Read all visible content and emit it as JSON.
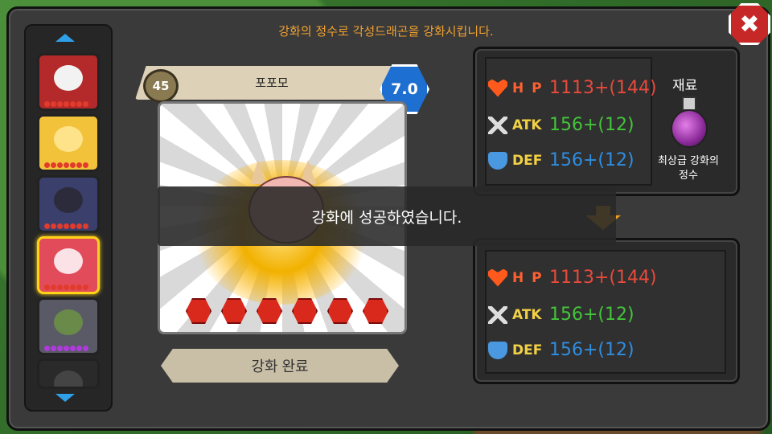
{
  "header": {
    "instruction": "강화의 정수로 각성드래곤을 강화시킵니다."
  },
  "close_button": {
    "icon": "close-icon",
    "glyph": "✖"
  },
  "dragon_list": {
    "items": [
      {
        "name": "dragon-1",
        "bg": "#b42a2a",
        "face": "#f2f2f2",
        "star_color": "#e23b2b",
        "selected": false
      },
      {
        "name": "dragon-2",
        "bg": "#f2c33a",
        "face": "#ffe38a",
        "star_color": "#e23b2b",
        "selected": false
      },
      {
        "name": "dragon-3",
        "bg": "#3b3f6b",
        "face": "#2b2b3b",
        "star_color": "#e23b2b",
        "selected": false
      },
      {
        "name": "dragon-4",
        "bg": "#e24b5a",
        "face": "#fbe2e6",
        "star_color": "#e23b2b",
        "selected": true
      },
      {
        "name": "dragon-5",
        "bg": "#5a5a66",
        "face": "#6a8a4a",
        "star_color": "#b03ae0",
        "selected": false
      },
      {
        "name": "dragon-6",
        "bg": "#2a2a2a",
        "face": "#444",
        "star_color": "#e23b2b",
        "selected": false
      }
    ]
  },
  "dragon_card": {
    "name": "포포모",
    "level": "45",
    "grade": "7.0",
    "gems": 6
  },
  "toast": {
    "message": "강화에 성공하였습니다."
  },
  "complete_button": {
    "label": "강화 완료"
  },
  "before": {
    "hp_label": "H P",
    "hp_value": "1113+(144)",
    "atk_label": "ATK",
    "atk_value": "156+(12)",
    "def_label": "DEF",
    "def_value": "156+(12)"
  },
  "after": {
    "hp_label": "H P",
    "hp_value": "1113+(144)",
    "atk_label": "ATK",
    "atk_value": "156+(12)",
    "def_label": "DEF",
    "def_value": "156+(12)"
  },
  "material": {
    "title": "재료",
    "name_line1": "최상급 강화의",
    "name_line2": "정수"
  }
}
